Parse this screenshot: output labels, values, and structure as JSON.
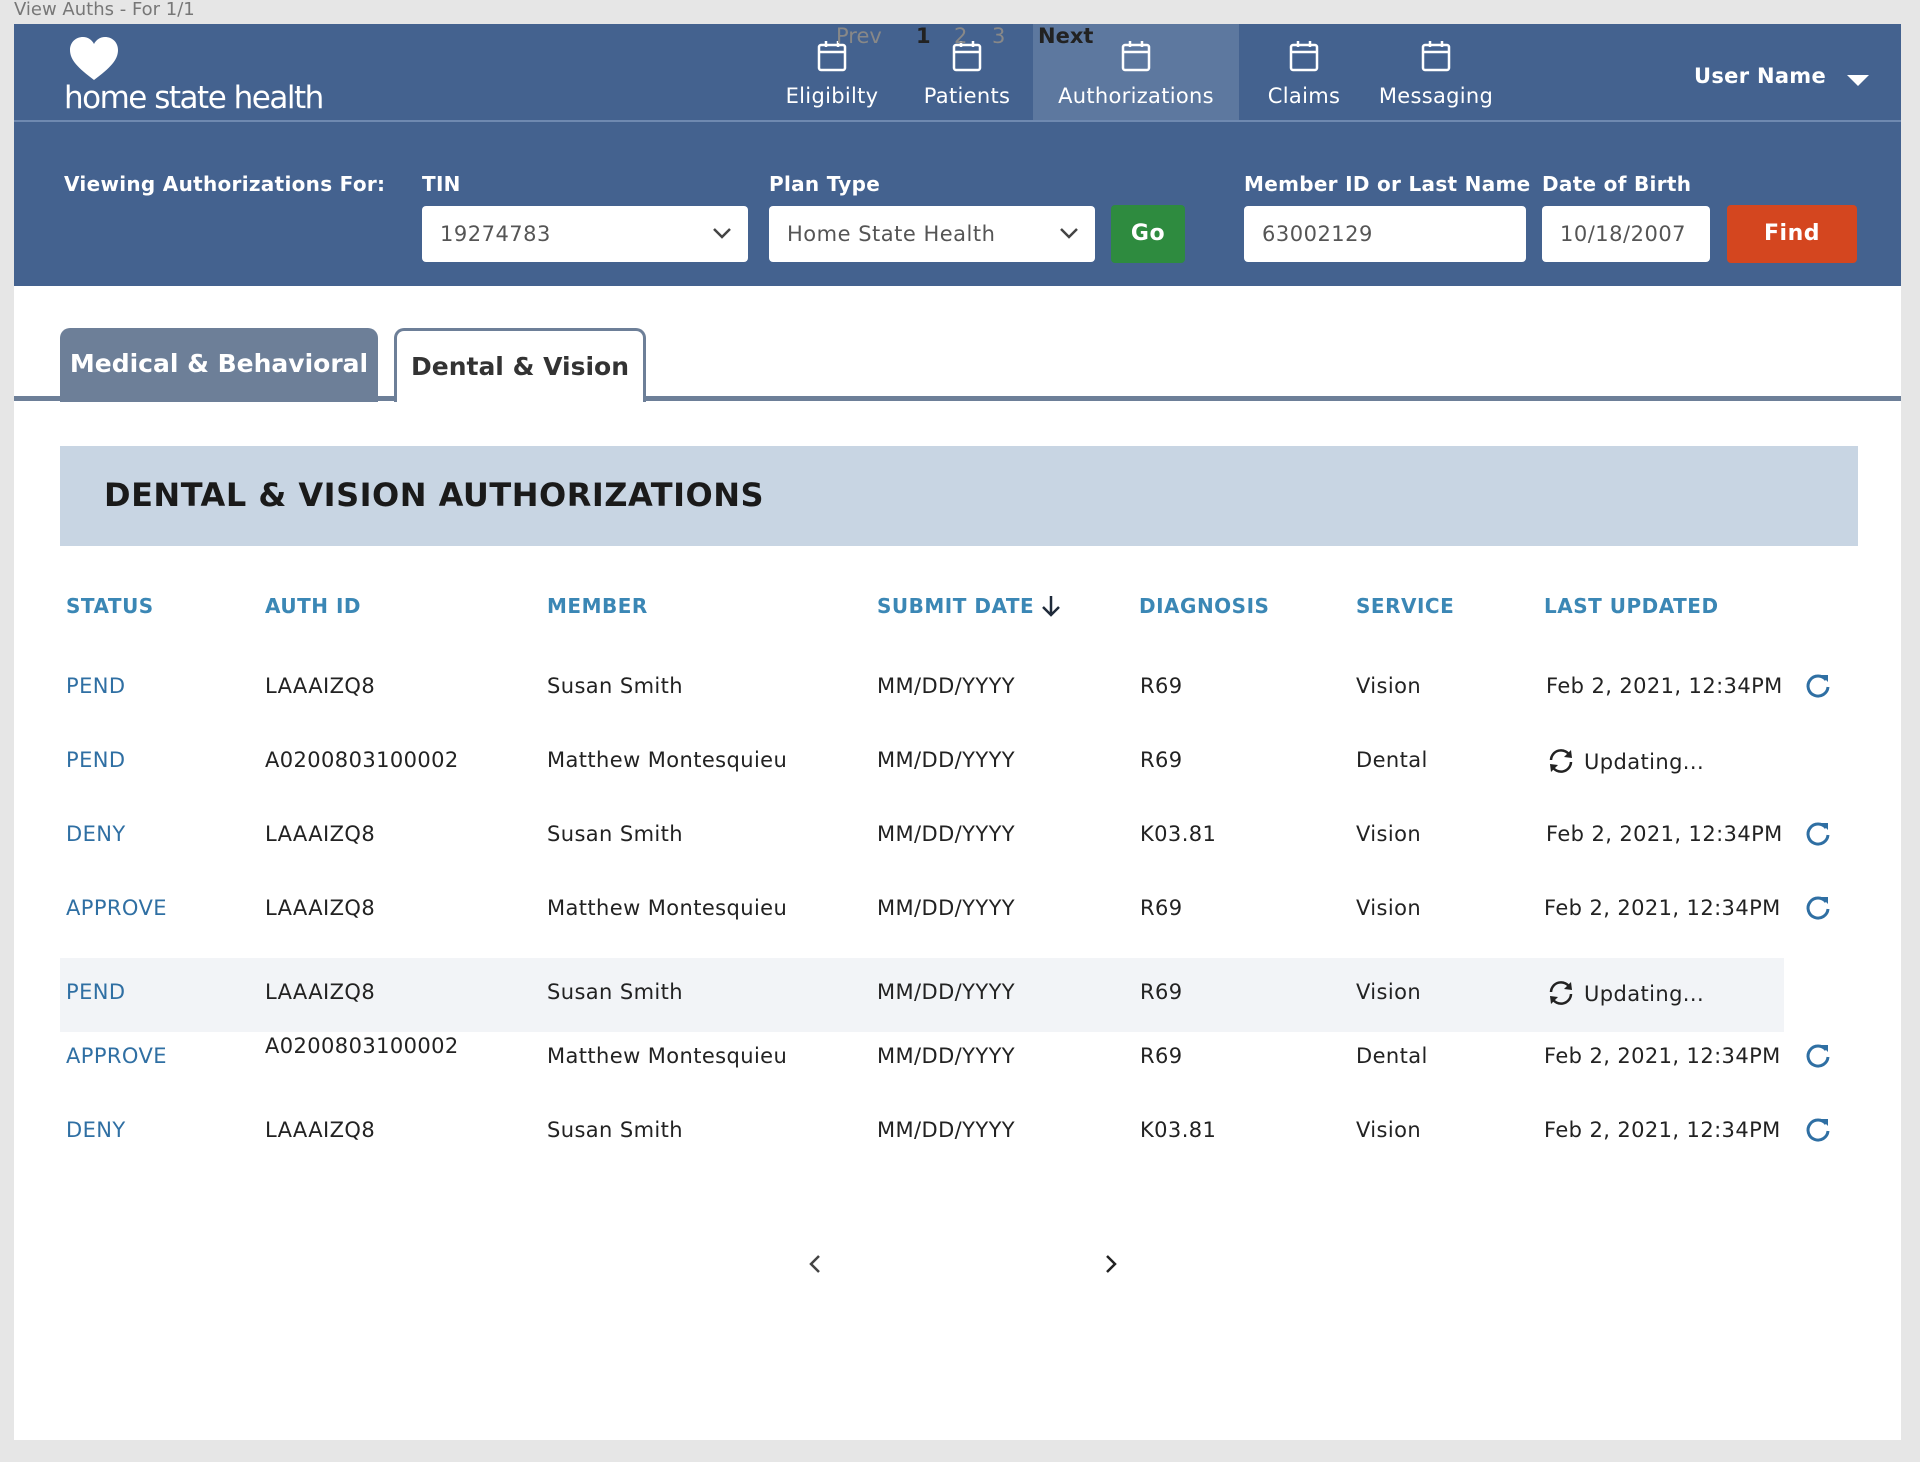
{
  "window": {
    "title": "View Auths - For 1/1"
  },
  "brand": {
    "logo_text": "home state health"
  },
  "nav": {
    "items": [
      {
        "label": "Eligibilty",
        "icon": "calendar-icon"
      },
      {
        "label": "Patients",
        "icon": "calendar-icon"
      },
      {
        "label": "Authorizations",
        "icon": "calendar-icon",
        "active": true
      },
      {
        "label": "Claims",
        "icon": "calendar-icon"
      },
      {
        "label": "Messaging",
        "icon": "calendar-icon"
      }
    ],
    "user_name": "User Name"
  },
  "filters": {
    "viewing_label": "Viewing Authorizations For:",
    "tin_label": "TIN",
    "tin_value": "19274783",
    "plan_label": "Plan Type",
    "plan_value": "Home State Health",
    "go_label": "Go",
    "member_label": "Member ID or Last Name",
    "member_value": "63002129",
    "dob_label": "Date of Birth",
    "dob_value": "10/18/2007",
    "find_label": "Find"
  },
  "tabs": [
    {
      "label": "Medical & Behavioral",
      "active": false
    },
    {
      "label": "Dental & Vision",
      "active": true
    }
  ],
  "section": {
    "title": "DENTAL & VISION AUTHORIZATIONS"
  },
  "table": {
    "columns": {
      "status": "STATUS",
      "auth_id": "AUTH ID",
      "member": "MEMBER",
      "submit_date": "SUBMIT DATE",
      "diagnosis": "DIAGNOSIS",
      "service": "SERVICE",
      "last_updated": "LAST UPDATED"
    },
    "rows": [
      {
        "status": "PEND",
        "auth_id": "LAAAIZQ8",
        "member": "Susan Smith",
        "submit_date": "MM/DD/YYYY",
        "diagnosis": "R69",
        "service": "Vision",
        "last_updated": "Feb 2, 2021, 12:34PM"
      },
      {
        "status": "PEND",
        "auth_id": "A0200803100002",
        "member": "Matthew Montesquieu",
        "submit_date": "MM/DD/YYYY",
        "diagnosis": "R69",
        "service": "Dental",
        "last_updated": "Updating..."
      },
      {
        "status": "DENY",
        "auth_id": "LAAAIZQ8",
        "member": "Susan Smith",
        "submit_date": "MM/DD/YYYY",
        "diagnosis": "K03.81",
        "service": "Vision",
        "last_updated": "Feb 2, 2021, 12:34PM"
      },
      {
        "status": "APPROVE",
        "auth_id": "LAAAIZQ8",
        "member": "Matthew Montesquieu",
        "submit_date": "MM/DD/YYYY",
        "diagnosis": "R69",
        "service": "Vision",
        "last_updated": "Feb 2, 2021, 12:34PM"
      },
      {
        "status": "PEND",
        "auth_id": "LAAAIZQ8",
        "member": "Susan Smith",
        "submit_date": "MM/DD/YYYY",
        "diagnosis": "R69",
        "service": "Vision",
        "last_updated": "Updating..."
      },
      {
        "status": "APPROVE",
        "auth_id": "A0200803100002",
        "member": "Matthew Montesquieu",
        "submit_date": "MM/DD/YYYY",
        "diagnosis": "R69",
        "service": "Dental",
        "last_updated": "Feb 2, 2021, 12:34PM"
      },
      {
        "status": "DENY",
        "auth_id": "LAAAIZQ8",
        "member": "Susan Smith",
        "submit_date": "MM/DD/YYYY",
        "diagnosis": "K03.81",
        "service": "Vision",
        "last_updated": "Feb 2, 2021, 12:34PM"
      }
    ]
  },
  "pagination": {
    "prev_label": "Prev",
    "pages": [
      "1",
      "2",
      "3"
    ],
    "current_page": "1",
    "next_label": "Next"
  },
  "colors": {
    "header_bg": "#44628f",
    "active_nav_bg": "#5d789f",
    "go_button": "#2e8b3f",
    "find_button": "#d4461f",
    "link_blue": "#2f6fa3",
    "section_header_bg": "#c8d5e3"
  }
}
